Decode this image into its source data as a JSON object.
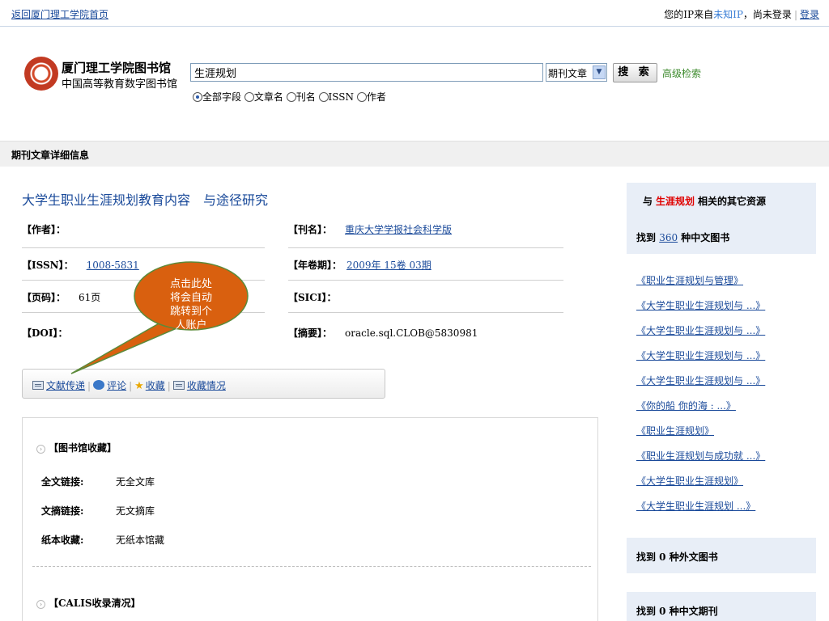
{
  "topbar": {
    "home_link": "返回厦门理工学院首页",
    "ip_prefix": "您的IP来自",
    "ip_value": "未知IP",
    "not_logged": "，尚未登录",
    "login_link": "登录"
  },
  "logo": {
    "name": "厦门理工学院图书馆",
    "subtitle": "中国高等教育数字图书馆"
  },
  "search": {
    "query": "生涯规划",
    "type_selected": "期刊文章",
    "button": "搜 索",
    "advanced": "高级检索",
    "scopes": [
      {
        "label": "全部字段",
        "checked": true
      },
      {
        "label": "文章名",
        "checked": false
      },
      {
        "label": "刊名",
        "checked": false
      },
      {
        "label": "ISSN",
        "checked": false
      },
      {
        "label": "作者",
        "checked": false
      }
    ]
  },
  "section_title": "期刊文章详细信息",
  "article": {
    "title": "大学生职业生涯规划教育内容　与途径研究",
    "author_label": "【作者】：",
    "author_value": "",
    "journal_label": "【刊名】：",
    "journal_value": "重庆大学学报社会科学版",
    "issn_label": "【ISSN】：",
    "issn_value": "1008-5831",
    "volume_label": "【年卷期】：",
    "volume_value": "2009年 15卷 03期",
    "pages_label": "【页码】：",
    "pages_value": "61页",
    "sici_label": "【SICI】：",
    "sici_value": "",
    "doi_label": "【DOI】：",
    "doi_value": "",
    "abstract_label": "【摘要】：",
    "abstract_value": "oracle.sql.CLOB@5830981"
  },
  "callout": {
    "line1": "点击此处",
    "line2": "将会自动",
    "line3": "跳转到个",
    "line4": "人账户",
    "fill": "#d9600f"
  },
  "actions": {
    "delivery": "文献传递",
    "comment": "评论",
    "favorite": "收藏",
    "favorite_status": "收藏情况"
  },
  "collection": {
    "library_head": "【图书馆收藏】",
    "fulltext_label": "全文链接:",
    "fulltext_value": "无全文库",
    "abstract_label": "文摘链接:",
    "abstract_value": "无文摘库",
    "print_label": "纸本收藏:",
    "print_value": "无纸本馆藏",
    "calis_head": "【CALIS收录清况】"
  },
  "related": {
    "prefix": "与",
    "keyword": "生涯规划",
    "suffix": "相关的其它资源",
    "cn_books_prefix": "找到",
    "cn_books_count": "360",
    "cn_books_suffix": "种中文图书",
    "books": [
      "《职业生涯规划与管理》",
      "《大学生职业生涯规划与 ...》",
      "《大学生职业生涯规划与 ...》",
      "《大学生职业生涯规划与 ...》",
      "《大学生职业生涯规划与 ...》",
      "《你的船 你的海 : ...》",
      "《职业生涯规划》",
      "《职业生涯规划与成功就 ...》",
      "《大学生职业生涯规划》",
      "《大学生职业生涯规划 ...》"
    ],
    "foreign_books": "找到 0 种外文图书",
    "cn_journals": "找到 0 种中文期刊"
  }
}
